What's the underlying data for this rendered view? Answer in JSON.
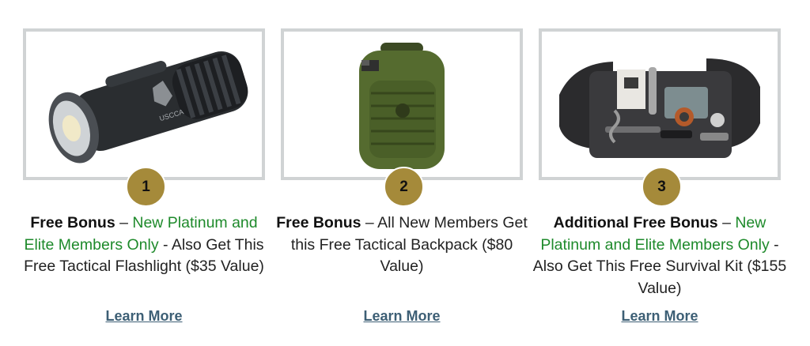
{
  "bonuses": [
    {
      "number": "1",
      "title": "Free Bonus",
      "dash": " – ",
      "highlight": "New Platinum and Elite Members Only",
      "rest": " - Also Get This Free Tactical Flashlight ($35 Value)",
      "link": "Learn More",
      "image_icon": "flashlight-image",
      "image_text": "USCCA"
    },
    {
      "number": "2",
      "title": "Free Bonus",
      "dash": " – ",
      "highlight": "",
      "rest": "All New Members Get this Free Tactical Backpack ($80 Value)",
      "link": "Learn More",
      "image_icon": "backpack-image"
    },
    {
      "number": "3",
      "title": "Additional Free Bonus",
      "dash": " – ",
      "highlight": "New Platinum and Elite Members Only",
      "rest": " - Also Get This Free Survival Kit ($155 Value)",
      "link": "Learn More",
      "image_icon": "survival-kit-image"
    }
  ],
  "colors": {
    "badge": "#a58a3a",
    "highlight": "#1e8a2b",
    "link": "#3d5f75",
    "frame": "#d0d3d4"
  }
}
